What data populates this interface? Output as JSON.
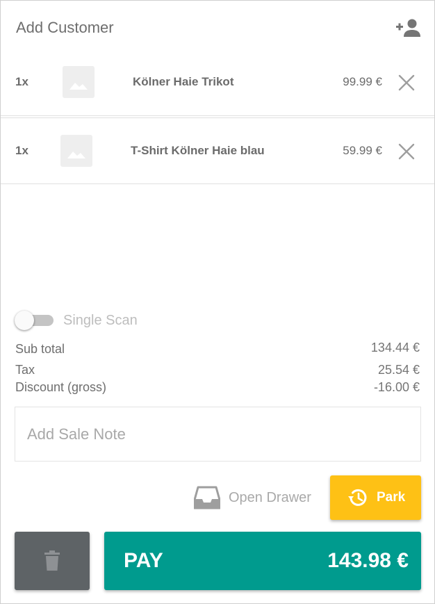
{
  "customer": {
    "label": "Add Customer",
    "add_icon": "add-person-icon"
  },
  "cart": {
    "items": [
      {
        "qty": "1x",
        "name": "Kölner Haie Trikot",
        "price": "99.99 €",
        "thumb_icon": "image-placeholder-icon"
      },
      {
        "qty": "1x",
        "name": "T-Shirt Kölner Haie blau",
        "price": "59.99 €",
        "thumb_icon": "image-placeholder-icon"
      }
    ],
    "remove_icon": "close-icon"
  },
  "scan_toggle": {
    "label": "Single Scan",
    "checked": false
  },
  "summary": {
    "subtotal_label": "Sub total",
    "subtotal_value": "134.44 €",
    "tax_label": "Tax",
    "tax_value": "25.54 €",
    "discount_label": "Discount (gross)",
    "discount_value": "-16.00 €"
  },
  "note": {
    "placeholder": "Add Sale Note"
  },
  "actions": {
    "drawer_label": "Open Drawer",
    "park_label": "Park",
    "pay_label": "PAY",
    "pay_total": "143.98 €"
  },
  "colors": {
    "pay": "#009b8e",
    "park": "#fec115",
    "trash": "#5e6366"
  }
}
